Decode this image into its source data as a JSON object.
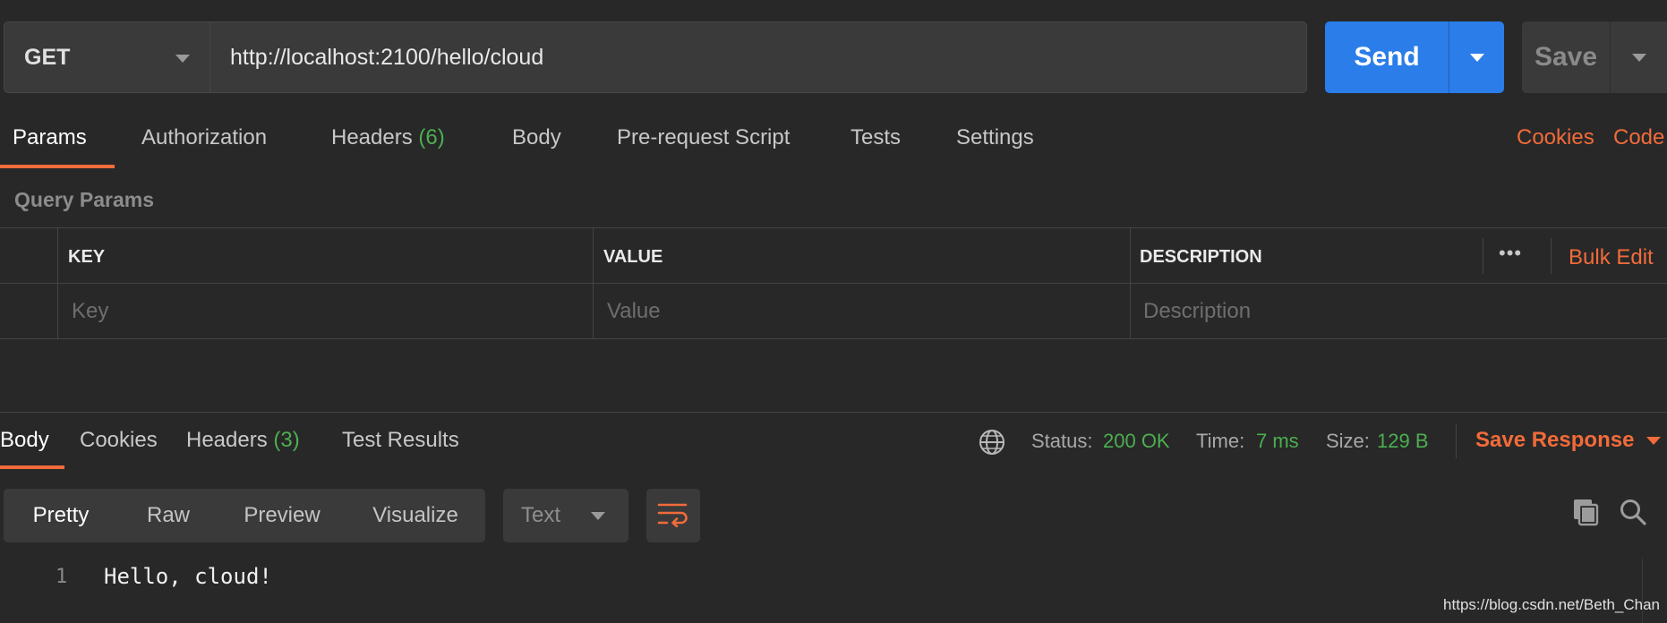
{
  "request": {
    "method": "GET",
    "url": "http://localhost:2100/hello/cloud",
    "send_label": "Send",
    "save_label": "Save"
  },
  "request_tabs": {
    "params": "Params",
    "authorization": "Authorization",
    "headers": "Headers",
    "headers_count": "(6)",
    "body": "Body",
    "prerequest": "Pre-request Script",
    "tests": "Tests",
    "settings": "Settings",
    "cookies": "Cookies",
    "code": "Code",
    "active": "Params"
  },
  "query_params": {
    "title": "Query Params",
    "columns": {
      "key": "KEY",
      "value": "VALUE",
      "description": "DESCRIPTION"
    },
    "more": "•••",
    "bulk_edit": "Bulk Edit",
    "placeholders": {
      "key": "Key",
      "value": "Value",
      "description": "Description"
    }
  },
  "response_tabs": {
    "body": "Body",
    "cookies": "Cookies",
    "headers": "Headers",
    "headers_count": "(3)",
    "test_results": "Test Results",
    "active": "Body"
  },
  "response_meta": {
    "status_label": "Status:",
    "status_value": "200 OK",
    "time_label": "Time:",
    "time_value": "7 ms",
    "size_label": "Size:",
    "size_value": "129 B",
    "save_response": "Save Response"
  },
  "viewer": {
    "modes": [
      "Pretty",
      "Raw",
      "Preview",
      "Visualize"
    ],
    "active_mode": "Pretty",
    "format": "Text",
    "lines": [
      {
        "no": "1",
        "text": "Hello, cloud!"
      }
    ]
  },
  "watermark": "https://blog.csdn.net/Beth_Chan",
  "colors": {
    "background": "#282828",
    "accent_orange": "#f26b3a",
    "send_blue": "#2b7de9",
    "success_green": "#4caf50"
  },
  "icons": [
    "chevron-down-icon",
    "globe-icon",
    "wrap-lines-icon",
    "copy-icon",
    "search-icon",
    "more-icon"
  ]
}
